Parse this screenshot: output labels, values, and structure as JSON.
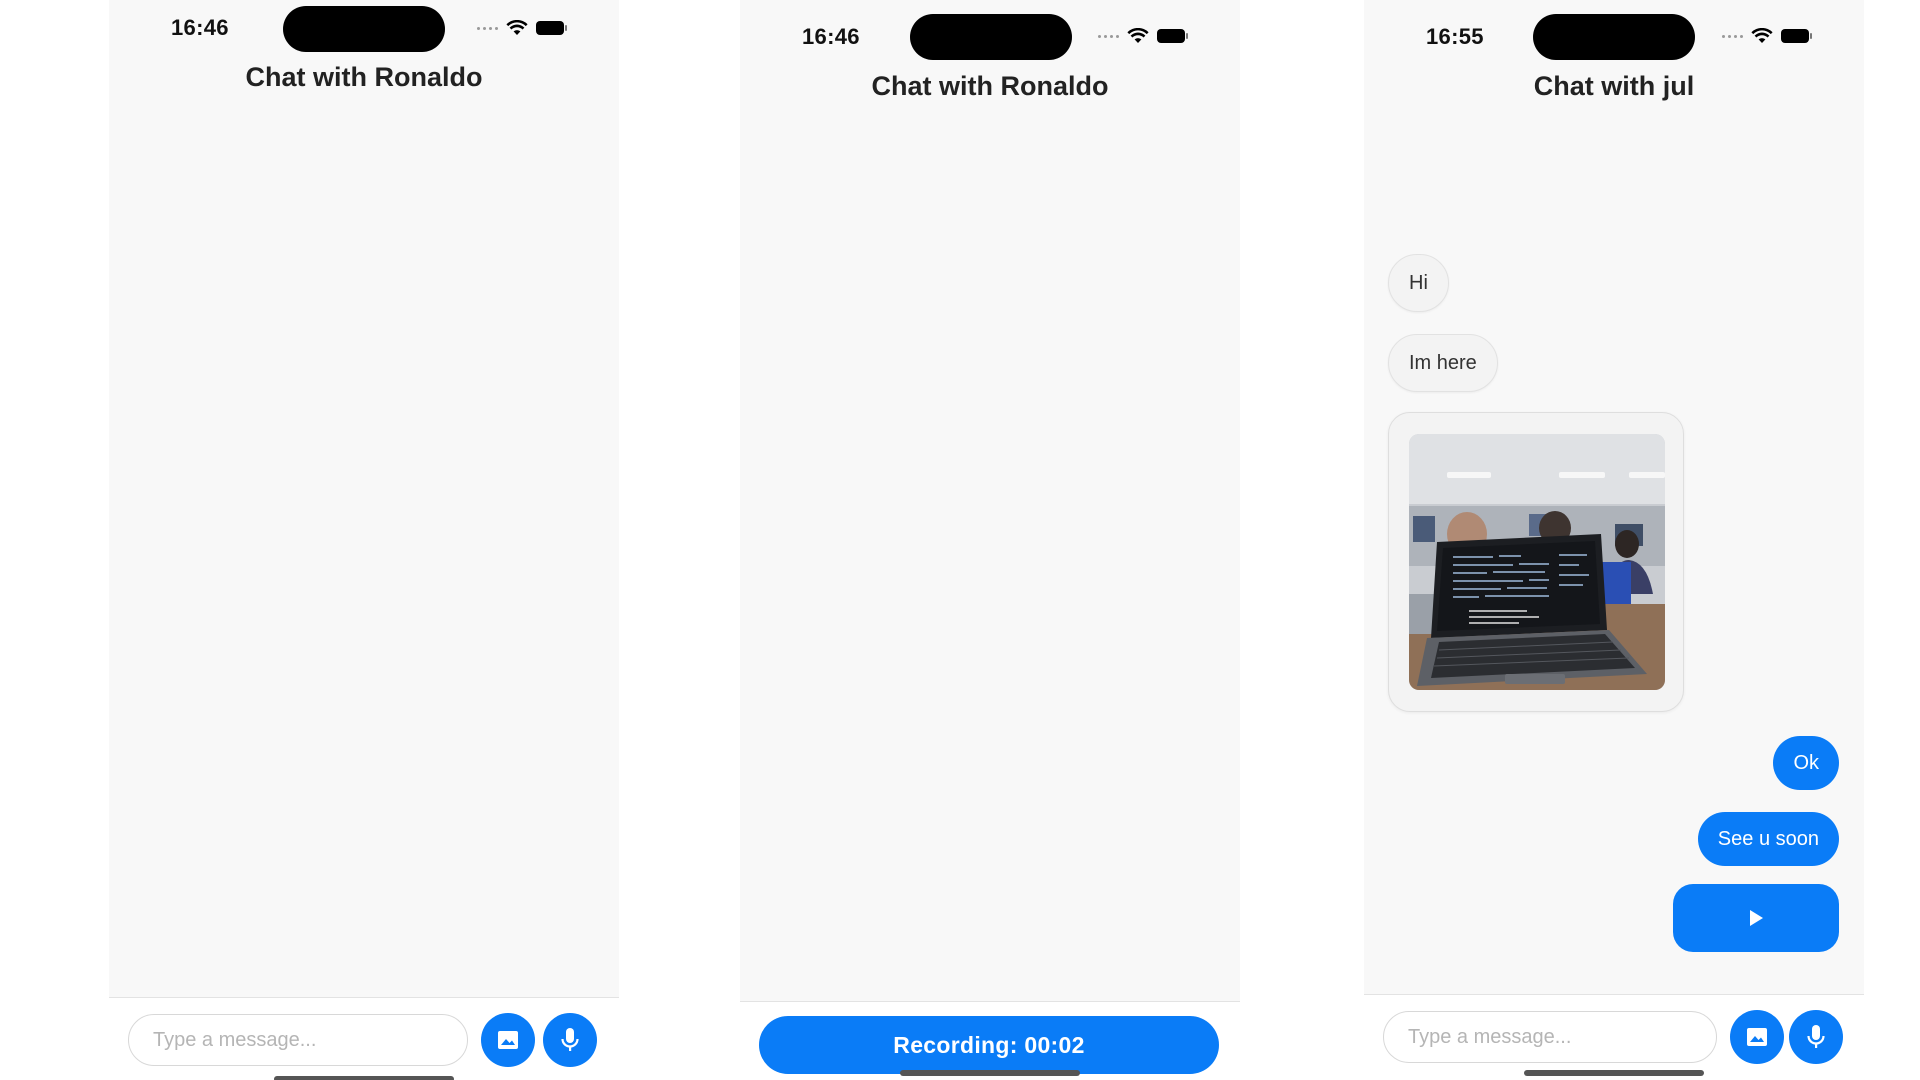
{
  "phones": [
    {
      "status_time": "16:46",
      "chat_title": "Chat with Ronaldo",
      "input_placeholder": "Type a message..."
    },
    {
      "status_time": "16:46",
      "chat_title": "Chat with Ronaldo",
      "recording_text": "Recording: 00:02"
    },
    {
      "status_time": "16:55",
      "chat_title": "Chat with jul",
      "messages": [
        {
          "from": "them",
          "text": "Hi"
        },
        {
          "from": "them",
          "text": "Im here"
        },
        {
          "from": "them",
          "type": "image"
        },
        {
          "from": "me",
          "text": "Ok"
        },
        {
          "from": "me",
          "text": "See u soon"
        },
        {
          "from": "me",
          "type": "audio"
        }
      ],
      "input_placeholder": "Type a message..."
    }
  ],
  "icons": {
    "image_button": "image-icon",
    "mic_button": "microphone-icon",
    "play": "play-icon",
    "wifi": "wifi-icon",
    "battery": "battery-icon",
    "signal": "signal-icon"
  },
  "colors": {
    "accent": "#0a7cf7",
    "background": "#f8f8f8",
    "incoming_bubble": "#f3f3f3"
  }
}
